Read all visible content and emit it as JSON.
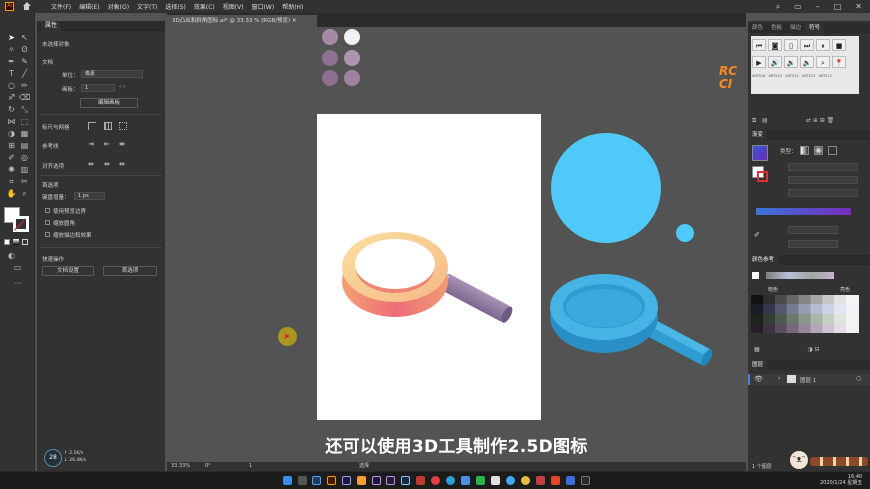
{
  "menubar": {
    "logo_text": "Ai",
    "menu": [
      "文件(F)",
      "编辑(E)",
      "对象(O)",
      "文字(T)",
      "选择(S)",
      "效果(C)",
      "视图(V)",
      "窗口(W)",
      "帮助(H)"
    ]
  },
  "document": {
    "tab_title": "3D凸出和斜角图标.ai* @ 33.33 % (RGB/预览)"
  },
  "properties": {
    "tab": "属性",
    "no_selection": "未选择对象",
    "doc_section": "文档",
    "unit_label": "单位：",
    "unit_value": "像素",
    "artboard_label": "画板：",
    "artboard_value": "1",
    "edit_artboard_button": "编辑画板",
    "rulers_grids": "标尺与网格",
    "guides": "参考线",
    "align": "对齐选项",
    "preferences": "首选项",
    "keyboard_increment_label": "键盘增量：",
    "keyboard_increment_value": "1 px",
    "option_preview_bounds": "使用预览边界",
    "option_scale_corners": "缩放圆角",
    "option_scale_strokes": "缩放描边和效果",
    "quick_actions": "快速操作",
    "doc_setup_button": "文档设置",
    "prefs_button": "首选项"
  },
  "canvas": {
    "subtitle": "还可以使用3D工具制作2.5D图标",
    "watermark": "RC CI",
    "cursor_badge": "28",
    "cursor_stats": [
      "↑ 2.1K/s",
      "↓ 26.4K/s"
    ]
  },
  "status": {
    "zoom": "33.33%",
    "rotation": "0°",
    "page": "1",
    "tool": "选择"
  },
  "right_panel": {
    "tabs1": [
      "颜色",
      "色板",
      "描边",
      "符号"
    ],
    "active_tab1": "符号",
    "symbol_labels": [
      "ARTS16",
      "ARTS15",
      "ARTS14",
      "ARTS13",
      "ARTS12"
    ],
    "gradient_tab": "渐变",
    "gradient_type_label": "类型：",
    "color_guide_tab": "颜色参考",
    "tint_label": "暗色",
    "tone_label": "亮色",
    "layers_tab": "图层",
    "layer_name": "图层 1",
    "layers_count": "1 个图层"
  },
  "taskbar": {
    "time": "16:40",
    "date": "2020/1/24 星期五"
  },
  "colors": {
    "accent_cyan": "#4cc4f5",
    "accent_blue": "#2f9dd4",
    "glass_handle": "#8e7aa0",
    "ring_top": "#f9d98d",
    "ring_side": "#ee7b76",
    "ai_orange": "#ff9a00"
  }
}
